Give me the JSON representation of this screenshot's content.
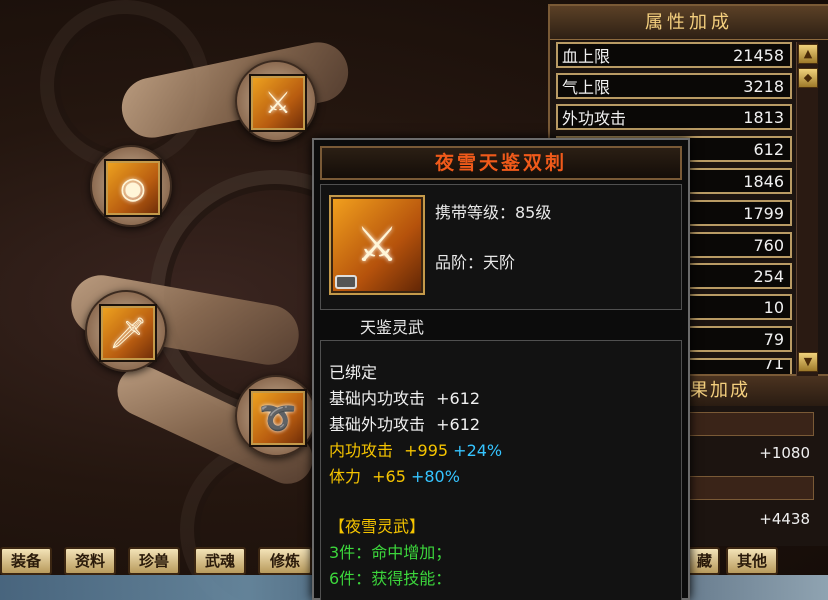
{
  "attr_panel": {
    "title": "属性加成",
    "rows": [
      {
        "label": "血上限",
        "value": "21458"
      },
      {
        "label": "气上限",
        "value": "3218"
      },
      {
        "label": "外功攻击",
        "value": "1813"
      },
      {
        "label": "",
        "value": "612"
      },
      {
        "label": "",
        "value": "1846"
      },
      {
        "label": "",
        "value": "1799"
      },
      {
        "label": "",
        "value": "760"
      },
      {
        "label": "",
        "value": "254"
      },
      {
        "label": "",
        "value": "10"
      },
      {
        "label": "",
        "value": "79"
      }
    ],
    "partial_value": "71"
  },
  "effect_panel": {
    "title": "果加成",
    "values": [
      "+1080",
      "+4438"
    ]
  },
  "tabs": [
    "装备",
    "资料",
    "珍兽",
    "武魂",
    "修炼",
    "藏",
    "其他"
  ],
  "tooltip": {
    "name": "夜雪天鉴双刺",
    "carry_level": "携带等级：85级",
    "grade": "品阶：天阶",
    "category": "天鉴灵武",
    "bound": "已绑定",
    "base_stats": [
      {
        "label": "基础内功攻击",
        "value": "+612"
      },
      {
        "label": "基础外功攻击",
        "value": "+612"
      }
    ],
    "bonus_stats": [
      {
        "label": "内功攻击",
        "value": "+995",
        "pct": "+24%"
      },
      {
        "label": "体力",
        "value": "+65",
        "pct": "+80%"
      }
    ],
    "set_name": "【夜雪灵武】",
    "set_effects": [
      {
        "count": "3件：",
        "text": "命中增加；"
      },
      {
        "count": "6件：",
        "text": "获得技能："
      }
    ]
  },
  "colors": {
    "title_orange": "#f05a1a",
    "bonus_yellow": "#f5c400",
    "pct_cyan": "#35c4ff",
    "set_green": "#3cd63c",
    "panel_gold": "#f4cf7e"
  }
}
